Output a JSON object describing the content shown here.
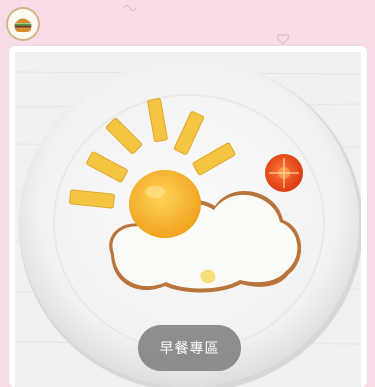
{
  "theme": {
    "background": "#f6dde8",
    "card": "#ffffff",
    "button_overlay": "#787878",
    "button_text": "#ffffff"
  },
  "header": {
    "logo_icon": "hamburger-icon"
  },
  "hero": {
    "image_description_icon": "breakfast-photo",
    "category_label": "早餐專區"
  }
}
